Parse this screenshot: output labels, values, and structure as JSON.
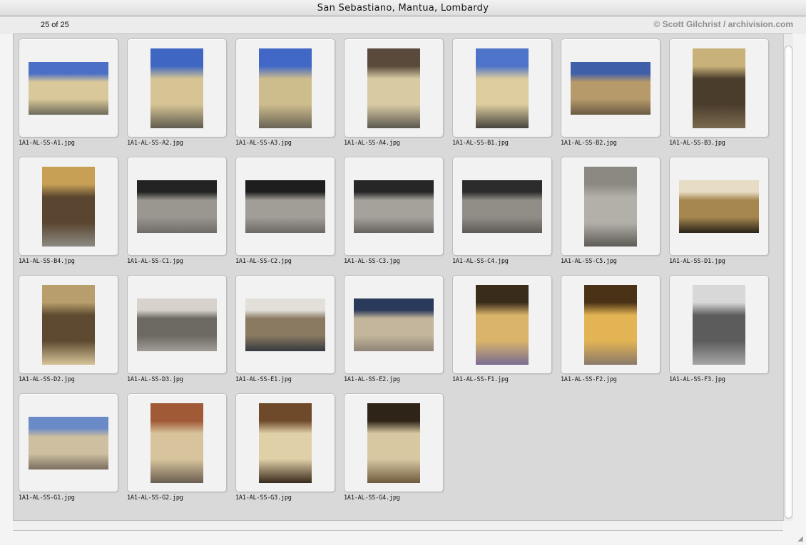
{
  "window": {
    "title": "San Sebastiano, Mantua, Lombardy"
  },
  "header": {
    "count": "25 of 25",
    "credit": "© Scott Gilchrist / archivision.com"
  },
  "thumbnails": [
    {
      "file": "1A1-AL-SS-A1.jpg",
      "orientation": "land",
      "colors": [
        "#4a6fc4",
        "#d9c99a",
        "#6e6a5a"
      ]
    },
    {
      "file": "1A1-AL-SS-A2.jpg",
      "orientation": "port",
      "colors": [
        "#3e66c2",
        "#d6c494",
        "#5f5b4f"
      ]
    },
    {
      "file": "1A1-AL-SS-A3.jpg",
      "orientation": "port",
      "colors": [
        "#4168c6",
        "#cdbc8c",
        "#6a6456"
      ]
    },
    {
      "file": "1A1-AL-SS-A4.jpg",
      "orientation": "port",
      "colors": [
        "#5a4a3c",
        "#d8cba4",
        "#5c5850"
      ]
    },
    {
      "file": "1A1-AL-SS-B1.jpg",
      "orientation": "port",
      "colors": [
        "#4d74c8",
        "#dccc9e",
        "#47443e"
      ]
    },
    {
      "file": "1A1-AL-SS-B2.jpg",
      "orientation": "land",
      "colors": [
        "#3f5fa8",
        "#b79a6a",
        "#6a5a44"
      ]
    },
    {
      "file": "1A1-AL-SS-B3.jpg",
      "orientation": "port",
      "colors": [
        "#c9b27a",
        "#4b3d2c",
        "#7a6a50"
      ]
    },
    {
      "file": "1A1-AL-SS-B4.jpg",
      "orientation": "port",
      "colors": [
        "#c7a056",
        "#5a4630",
        "#8d8a82"
      ]
    },
    {
      "file": "1A1-AL-SS-C1.jpg",
      "orientation": "land",
      "colors": [
        "#222222",
        "#9a9690",
        "#6f6b66"
      ]
    },
    {
      "file": "1A1-AL-SS-C2.jpg",
      "orientation": "land",
      "colors": [
        "#1e1e1e",
        "#a19d97",
        "#6c6863"
      ]
    },
    {
      "file": "1A1-AL-SS-C3.jpg",
      "orientation": "land",
      "colors": [
        "#262626",
        "#a5a29c",
        "#67635e"
      ]
    },
    {
      "file": "1A1-AL-SS-C4.jpg",
      "orientation": "land",
      "colors": [
        "#2b2b2b",
        "#908c86",
        "#5e5a55"
      ]
    },
    {
      "file": "1A1-AL-SS-C5.jpg",
      "orientation": "port",
      "colors": [
        "#8c8882",
        "#b3afa9",
        "#5e5a55"
      ]
    },
    {
      "file": "1A1-AL-SS-D1.jpg",
      "orientation": "land",
      "colors": [
        "#e7dcc4",
        "#a5874f",
        "#2a2218"
      ]
    },
    {
      "file": "1A1-AL-SS-D2.jpg",
      "orientation": "port",
      "colors": [
        "#b89e6c",
        "#5e4a30",
        "#d6c49a"
      ]
    },
    {
      "file": "1A1-AL-SS-D3.jpg",
      "orientation": "land",
      "colors": [
        "#d7d3cc",
        "#6c6862",
        "#a19d96"
      ]
    },
    {
      "file": "1A1-AL-SS-E1.jpg",
      "orientation": "land",
      "colors": [
        "#e3e0da",
        "#8a7a62",
        "#35383e"
      ]
    },
    {
      "file": "1A1-AL-SS-E2.jpg",
      "orientation": "land",
      "colors": [
        "#2a3a5a",
        "#c4b69c",
        "#8f8576"
      ]
    },
    {
      "file": "1A1-AL-SS-F1.jpg",
      "orientation": "port",
      "colors": [
        "#3a2c1a",
        "#d9b46a",
        "#7a6c92"
      ]
    },
    {
      "file": "1A1-AL-SS-F2.jpg",
      "orientation": "port",
      "colors": [
        "#4a3216",
        "#e2b454",
        "#8a7a6a"
      ]
    },
    {
      "file": "1A1-AL-SS-F3.jpg",
      "orientation": "port",
      "colors": [
        "#d8d8d8",
        "#5c5c5c",
        "#a6a6a6"
      ]
    },
    {
      "file": "1A1-AL-SS-G1.jpg",
      "orientation": "land",
      "colors": [
        "#6a8ac8",
        "#cdbfa0",
        "#7a6e60"
      ]
    },
    {
      "file": "1A1-AL-SS-G2.jpg",
      "orientation": "port",
      "colors": [
        "#a05a36",
        "#d7c49c",
        "#6a5e50"
      ]
    },
    {
      "file": "1A1-AL-SS-G3.jpg",
      "orientation": "port",
      "colors": [
        "#6e4a2a",
        "#e0d0a8",
        "#3a2a1c"
      ]
    },
    {
      "file": "1A1-AL-SS-G4.jpg",
      "orientation": "port",
      "colors": [
        "#2e2418",
        "#d8c8a2",
        "#6e5a3e"
      ]
    }
  ]
}
